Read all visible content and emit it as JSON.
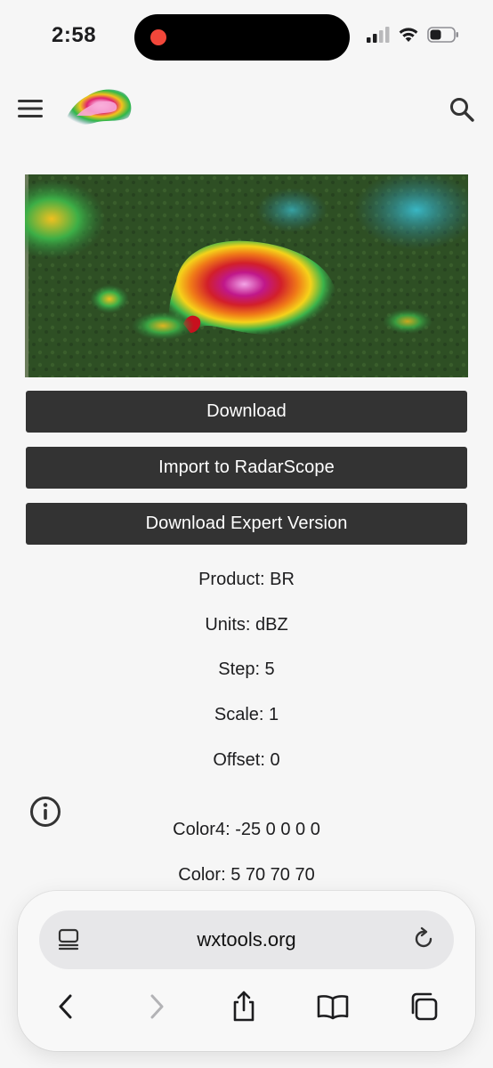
{
  "status_bar": {
    "time": "2:58"
  },
  "header": {
    "logo_icon": "radar-logo-icon",
    "menu_icon": "hamburger-menu-icon",
    "search_icon": "search-icon"
  },
  "buttons": {
    "download": "Download",
    "import": "Import to RadarScope",
    "expert": "Download Expert Version"
  },
  "info": {
    "product": "Product: BR",
    "units": "Units: dBZ",
    "step": "Step: 5",
    "scale": "Scale: 1",
    "offset": "Offset: 0",
    "color4": "Color4: -25 0 0 0 0",
    "color": "Color: 5 70 70 70"
  },
  "browser": {
    "url": "wxtools.org"
  },
  "colors": {
    "button_bg": "#333333",
    "page_bg": "#f6f6f6",
    "recording_dot": "#f2473a"
  }
}
